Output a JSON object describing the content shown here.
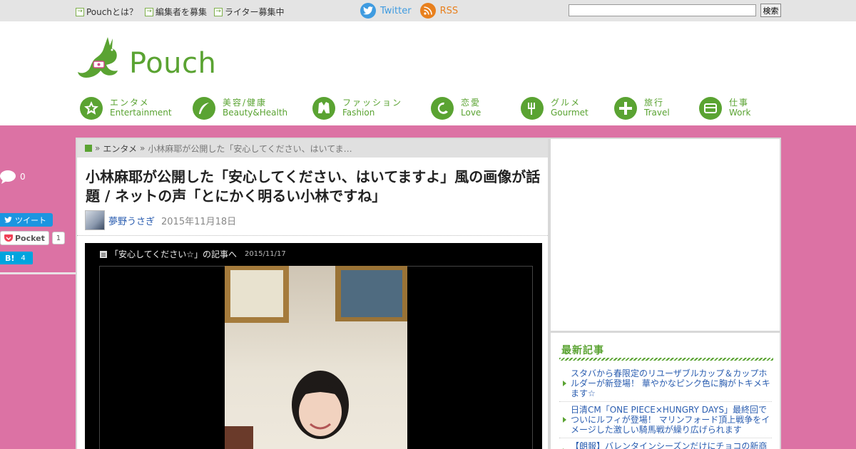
{
  "topbar": {
    "links": [
      "Pouchとは？",
      "編集者を募集",
      "ライター募集中"
    ],
    "twitter_label": "Twitter",
    "rss_label": "RSS",
    "search_placeholder": "",
    "search_button": "検索"
  },
  "header": {
    "logo_text": "Pouch",
    "nav": [
      {
        "jp": "エンタメ",
        "en": "Entertainment",
        "icon": "star-icon"
      },
      {
        "jp": "美容/健康",
        "en": "Beauty&Health",
        "icon": "feather-icon"
      },
      {
        "jp": "ファッション",
        "en": "Fashion",
        "icon": "shirt-icon"
      },
      {
        "jp": "恋愛",
        "en": "Love",
        "icon": "heart-icon"
      },
      {
        "jp": "グルメ",
        "en": "Gourmet",
        "icon": "fork-icon"
      },
      {
        "jp": "旅行",
        "en": "Travel",
        "icon": "cross-icon"
      },
      {
        "jp": "仕事",
        "en": "Work",
        "icon": "card-icon"
      }
    ]
  },
  "share": {
    "comment_count": "0",
    "tweet_label": "ツイート",
    "pocket_label": "Pocket",
    "pocket_count": "1",
    "hatena_label": "B!",
    "hatena_count": "4"
  },
  "article": {
    "breadcrumb": {
      "sep": "»",
      "category": "エンタメ",
      "current": "小林麻耶が公開した「安心してください、はいてま…"
    },
    "title": "小林麻耶が公開した「安心してください、はいてますよ」風の画像が話題 / ネットの声「とにかく明るい小林ですね」",
    "author": "夢野うさぎ",
    "date": "2015年11月18日",
    "photo_caption": "「安心してください☆」の記事へ",
    "photo_date": "2015/11/17"
  },
  "sidebar": {
    "news_heading": "最新記事",
    "news": [
      "スタバから春限定のリユーザブルカップ＆カップホルダーが新登場！ 華やかなピンク色に胸がトキメキます☆",
      "日清CM「ONE PIECE×HUNGRY DAYS」最終回でついにルフィが登場！ マリンフォード頂上戦争をイメージした激しい騎馬戦が繰り広げられます",
      "【朗報】バレンタインシーズンだけにチョコの新商品が…"
    ]
  },
  "colors": {
    "brand_green": "#5aa332",
    "page_pink": "#dc72a4",
    "twitter_blue": "#3f9be0",
    "rss_orange": "#e8801e"
  }
}
